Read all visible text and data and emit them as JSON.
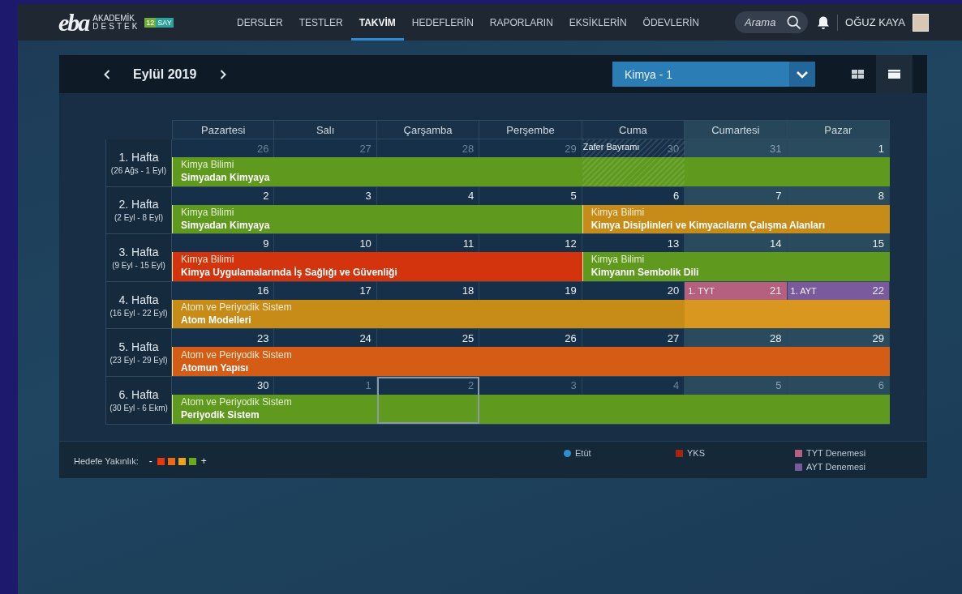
{
  "header": {
    "logo": {
      "mark": "eba",
      "line1": "AKADEMİK",
      "line2": "DESTEK",
      "grade": "12",
      "track": "SAY"
    },
    "nav": [
      {
        "label": "DERSLER",
        "selected": false
      },
      {
        "label": "TESTLER",
        "selected": false
      },
      {
        "label": "TAKVİM",
        "selected": true
      },
      {
        "label": "HEDEFLERİN",
        "selected": false
      },
      {
        "label": "RAPORLARIN",
        "selected": false
      },
      {
        "label": "EKSİKLERİN",
        "selected": false
      },
      {
        "label": "ÖDEVLERİN",
        "selected": false
      }
    ],
    "search": {
      "placeholder": "Arama"
    },
    "user": {
      "name": "OĞUZ KAYA"
    }
  },
  "calendar": {
    "month": "Eylül 2019",
    "subject_select": {
      "value": "Kimya - 1"
    },
    "view_buttons": [
      {
        "kind": "grid",
        "selected": false
      },
      {
        "kind": "single",
        "selected": true
      }
    ],
    "columns": [
      {
        "label": "Pazartesi",
        "weekend": false
      },
      {
        "label": "Salı",
        "weekend": false
      },
      {
        "label": "Çarşamba",
        "weekend": false
      },
      {
        "label": "Perşembe",
        "weekend": false
      },
      {
        "label": "Cuma",
        "weekend": false
      },
      {
        "label": "Cumartesi",
        "weekend": true
      },
      {
        "label": "Pazar",
        "weekend": true
      }
    ],
    "weeks": [
      {
        "label": "1. Hafta",
        "range": "(26 Ağs - 1 Eyl)",
        "days": [
          {
            "n": "26",
            "muted": true,
            "selected": false,
            "event": {
              "color": "#5f9a1f",
              "category": "Kimya Bilimi",
              "title": "Simyadan Kimyaya"
            }
          },
          {
            "n": "27",
            "muted": true,
            "selected": false
          },
          {
            "n": "28",
            "muted": true,
            "selected": false
          },
          {
            "n": "29",
            "muted": true,
            "selected": false
          },
          {
            "n": "30",
            "muted": true,
            "selected": false,
            "holiday": "Zafer Bayramı"
          },
          {
            "n": "31",
            "muted": true,
            "selected": false
          },
          {
            "n": "1",
            "muted": false,
            "selected": false
          }
        ]
      },
      {
        "label": "2. Hafta",
        "range": "(2 Eyl - 8 Eyl)",
        "days": [
          {
            "n": "2",
            "muted": false,
            "selected": false,
            "event": {
              "color": "#5f9a1f",
              "category": "Kimya Bilimi",
              "title": "Simyadan Kimyaya"
            }
          },
          {
            "n": "3",
            "muted": false,
            "selected": false
          },
          {
            "n": "4",
            "muted": false,
            "selected": false
          },
          {
            "n": "5",
            "muted": false,
            "selected": false
          },
          {
            "n": "6",
            "muted": false,
            "selected": false,
            "event": {
              "color": "#c78b18",
              "category": "Kimya Bilimi",
              "title": "Kimya Disiplinleri ve Kimyacıların Çalışma Alanları"
            }
          },
          {
            "n": "7",
            "muted": false,
            "selected": false
          },
          {
            "n": "8",
            "muted": false,
            "selected": false
          }
        ]
      },
      {
        "label": "3. Hafta",
        "range": "(9 Eyl - 15 Eyl)",
        "days": [
          {
            "n": "9",
            "muted": false,
            "selected": false,
            "event": {
              "color": "#d3340e",
              "category": "Kimya Bilimi",
              "title": "Kimya Uygulamalarında İş Sağlığı ve Güvenliği"
            }
          },
          {
            "n": "10",
            "muted": false,
            "selected": false
          },
          {
            "n": "11",
            "muted": false,
            "selected": false
          },
          {
            "n": "12",
            "muted": false,
            "selected": false
          },
          {
            "n": "13",
            "muted": false,
            "selected": false,
            "event": {
              "color": "#5f9a1f",
              "category": "Kimya Bilimi",
              "title": "Kimyanın Sembolik Dili"
            }
          },
          {
            "n": "14",
            "muted": false,
            "selected": false
          },
          {
            "n": "15",
            "muted": false,
            "selected": false
          }
        ]
      },
      {
        "label": "4. Hafta",
        "range": "(16 Eyl - 22 Eyl)",
        "days": [
          {
            "n": "16",
            "muted": false,
            "selected": false,
            "event": {
              "color": "#c78b18",
              "category": "Atom ve Periyodik Sistem",
              "title": "Atom Modelleri"
            }
          },
          {
            "n": "17",
            "muted": false,
            "selected": false
          },
          {
            "n": "18",
            "muted": false,
            "selected": false
          },
          {
            "n": "19",
            "muted": false,
            "selected": false
          },
          {
            "n": "20",
            "muted": false,
            "selected": false
          },
          {
            "n": "21",
            "muted": false,
            "selected": false,
            "exam": {
              "label": "1. TYT",
              "color": "#b5607f"
            }
          },
          {
            "n": "22",
            "muted": false,
            "selected": false,
            "exam": {
              "label": "1. AYT",
              "color": "#7a5a9c"
            }
          }
        ]
      },
      {
        "label": "5. Hafta",
        "range": "(23 Eyl - 29 Eyl)",
        "days": [
          {
            "n": "23",
            "muted": false,
            "selected": false,
            "event": {
              "color": "#d45c15",
              "category": "Atom ve Periyodik Sistem",
              "title": "Atomun Yapısı"
            }
          },
          {
            "n": "24",
            "muted": false,
            "selected": false
          },
          {
            "n": "25",
            "muted": false,
            "selected": false
          },
          {
            "n": "26",
            "muted": false,
            "selected": false
          },
          {
            "n": "27",
            "muted": false,
            "selected": false
          },
          {
            "n": "28",
            "muted": false,
            "selected": false
          },
          {
            "n": "29",
            "muted": false,
            "selected": false
          }
        ]
      },
      {
        "label": "6. Hafta",
        "range": "(30 Eyl - 6 Ekm)",
        "days": [
          {
            "n": "30",
            "muted": false,
            "selected": false,
            "event": {
              "color": "#5f9a1f",
              "category": "Atom ve Periyodik Sistem",
              "title": "Periyodik Sistem"
            }
          },
          {
            "n": "1",
            "muted": true,
            "selected": false
          },
          {
            "n": "2",
            "muted": true,
            "selected": true
          },
          {
            "n": "3",
            "muted": true,
            "selected": false
          },
          {
            "n": "4",
            "muted": true,
            "selected": false
          },
          {
            "n": "5",
            "muted": true,
            "selected": false
          },
          {
            "n": "6",
            "muted": true,
            "selected": false
          }
        ]
      }
    ]
  },
  "legend": {
    "proximity": {
      "label": "Hedefe Yakınlık:",
      "low": "-",
      "high": "+",
      "swatches": [
        {
          "color": "#e8380d"
        },
        {
          "color": "#ee6a12"
        },
        {
          "color": "#f0a01c"
        },
        {
          "color": "#6aaa1e"
        }
      ]
    },
    "items": [
      {
        "kind": "dot",
        "label": "Etüt",
        "color": "#2c8ed0"
      },
      {
        "kind": "square",
        "label": "YKS",
        "color": "#a8240e"
      },
      {
        "kind": "square",
        "label": "TYT Denemesi",
        "color": "#b5607f"
      },
      {
        "kind": "square",
        "label": "AYT Denemesi",
        "color": "#7a5a9c"
      }
    ]
  }
}
